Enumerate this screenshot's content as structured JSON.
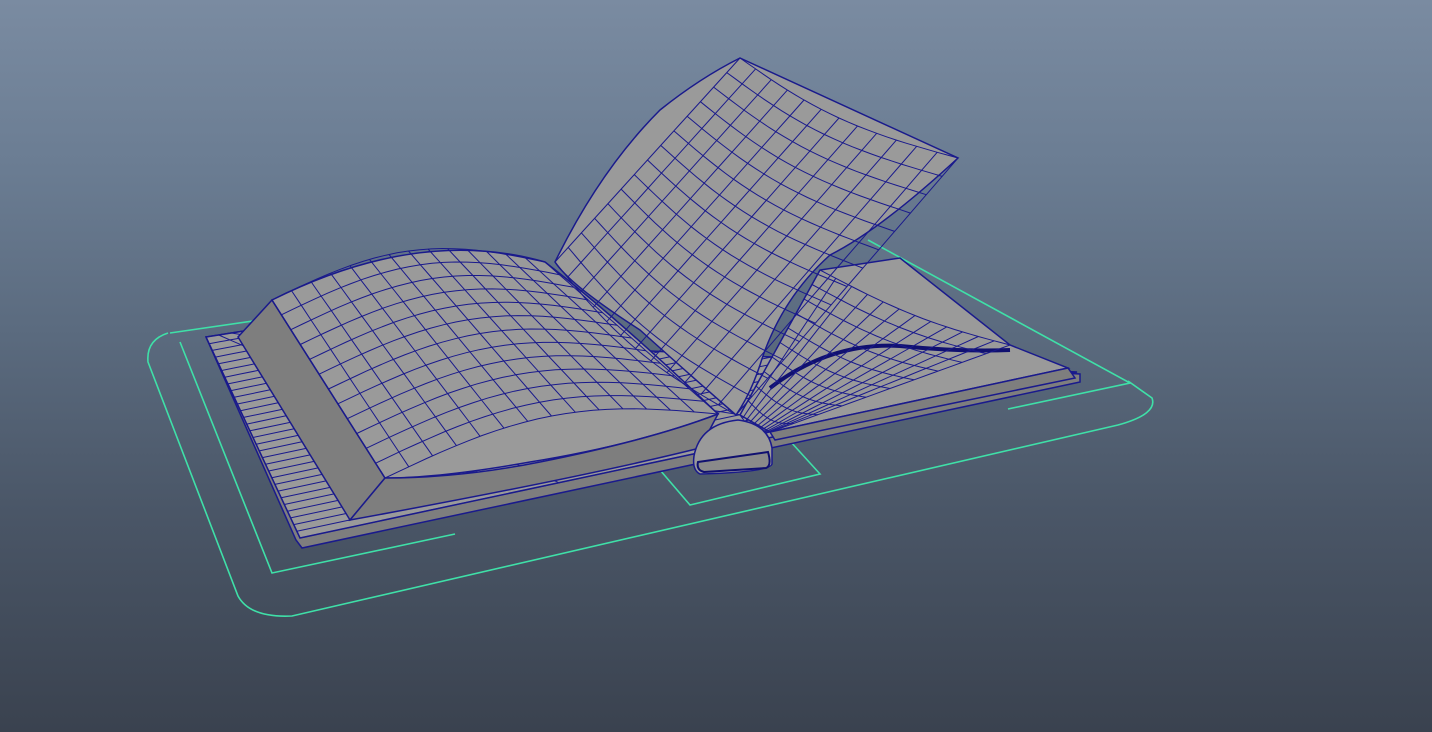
{
  "viewport": {
    "background_top": "#7a8ba1",
    "background_bottom": "#3a424f"
  },
  "scene": {
    "object": "open-book-model",
    "display_mode": "wireframe-on-shaded",
    "colors": {
      "mesh_fill": "#9a9a9a",
      "mesh_fill_shade": "#7e7e7e",
      "wire": "#1a1a8c",
      "rig_curve": "#3fe0a8"
    }
  }
}
